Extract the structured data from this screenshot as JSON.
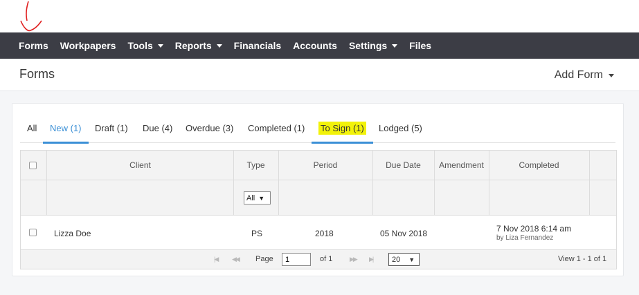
{
  "nav": {
    "items": [
      {
        "label": "Forms",
        "dropdown": false
      },
      {
        "label": "Workpapers",
        "dropdown": false
      },
      {
        "label": "Tools",
        "dropdown": true
      },
      {
        "label": "Reports",
        "dropdown": true
      },
      {
        "label": "Financials",
        "dropdown": false
      },
      {
        "label": "Accounts",
        "dropdown": false
      },
      {
        "label": "Settings",
        "dropdown": true
      },
      {
        "label": "Files",
        "dropdown": false
      }
    ]
  },
  "header": {
    "title": "Forms",
    "add_form_label": "Add Form"
  },
  "tabs": [
    {
      "label": "All"
    },
    {
      "label": "New (1)",
      "active": true
    },
    {
      "label": "Draft (1)"
    },
    {
      "label": "Due (4)"
    },
    {
      "label": "Overdue (3)"
    },
    {
      "label": "Completed (1)"
    },
    {
      "label": "To Sign (1)",
      "highlighted": true
    },
    {
      "label": "Lodged (5)"
    }
  ],
  "grid": {
    "columns": [
      "Client",
      "Type",
      "Period",
      "Due Date",
      "Amendment",
      "Completed"
    ],
    "type_filter": "All",
    "rows": [
      {
        "client": "Lizza Doe",
        "type": "PS",
        "period": "2018",
        "due_date": "05 Nov 2018",
        "amendment": "",
        "completed": "7 Nov 2018 6:14 am",
        "completed_by": "by Liza Fernandez"
      }
    ]
  },
  "pager": {
    "page_label": "Page",
    "page_value": "1",
    "of_label": "of 1",
    "page_size": "20",
    "view_text": "View 1 - 1 of 1"
  },
  "colors": {
    "nav_bg": "#3c3d45",
    "accent": "#3a8fd6",
    "highlight": "#f2f20a",
    "annotation": "#e02020"
  },
  "icons": [
    "caret-down-icon",
    "first-page-icon",
    "prev-page-icon",
    "next-page-icon",
    "last-page-icon"
  ]
}
